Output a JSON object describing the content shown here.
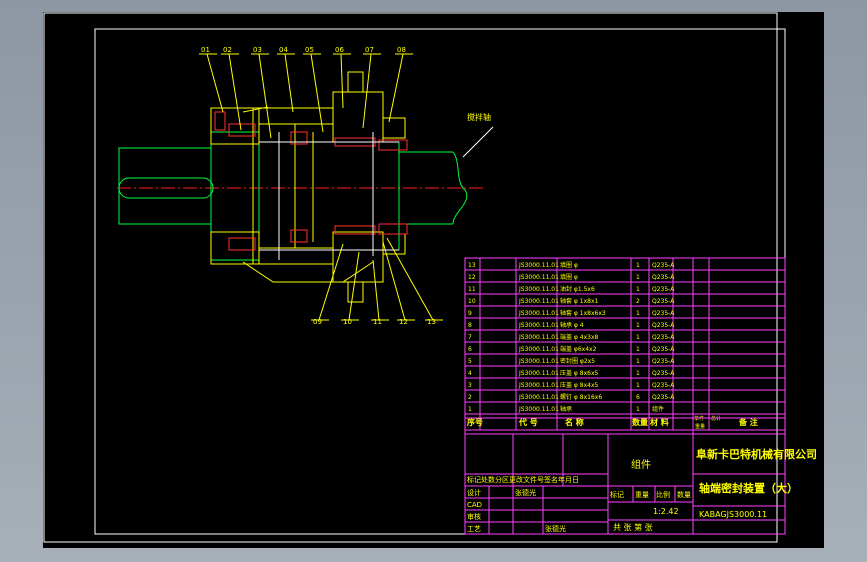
{
  "balloons": [
    "01",
    "02",
    "03",
    "04",
    "05",
    "06",
    "07",
    "08",
    "09",
    "10",
    "11",
    "12",
    "13"
  ],
  "shaft_label": "搅拌轴",
  "bom": [
    {
      "no": "13",
      "code": "JS3000.11.01",
      "name": "填圈 φ",
      "qty": "1",
      "mat": "Q235-A"
    },
    {
      "no": "12",
      "code": "JS3000.11.01",
      "name": "填圈 φ",
      "qty": "1",
      "mat": "Q235-A"
    },
    {
      "no": "11",
      "code": "JS3000.11.01",
      "name": "油封 φ1.5x6",
      "qty": "1",
      "mat": "Q235-A"
    },
    {
      "no": "10",
      "code": "JS3000.11.01",
      "name": "轴套 φ 1x8x1",
      "qty": "2",
      "mat": "Q235-A"
    },
    {
      "no": "9",
      "code": "JS3000.11.01",
      "name": "轴套 φ 1x8x6x3",
      "qty": "1",
      "mat": "Q235-A"
    },
    {
      "no": "8",
      "code": "JS3000.11.01",
      "name": "轴承 φ 4",
      "qty": "1",
      "mat": "Q235-A"
    },
    {
      "no": "7",
      "code": "JS3000.11.01",
      "name": "端盖 φ 4x3x8",
      "qty": "1",
      "mat": "Q235-A"
    },
    {
      "no": "6",
      "code": "JS3000.11.01",
      "name": "端盖 φ6x4x2",
      "qty": "1",
      "mat": "Q235-A"
    },
    {
      "no": "5",
      "code": "JS3000.11.01",
      "name": "密封圈 φ2x5",
      "qty": "1",
      "mat": "Q235-A"
    },
    {
      "no": "4",
      "code": "JS3000.11.01",
      "name": "压盖 φ 8x6x5",
      "qty": "1",
      "mat": "Q235-A"
    },
    {
      "no": "3",
      "code": "JS3000.11.01",
      "name": "压盖 φ 8x4x5",
      "qty": "1",
      "mat": "Q235-A"
    },
    {
      "no": "2",
      "code": "JS3000.11.01",
      "name": "螺钉 φ 8x16x6",
      "qty": "6",
      "mat": "Q235-A"
    },
    {
      "no": "1",
      "code": "JS3000.11.01",
      "name": "轴承",
      "qty": "1",
      "mat": "组件"
    }
  ],
  "bom_header": {
    "no": "序号",
    "code": "代  号",
    "name": "名  称",
    "qty": "数量",
    "mat": "材  料",
    "single": "单件",
    "total": "总计",
    "weight": "重量",
    "remark": "备  注"
  },
  "title_block": {
    "company": "阜新卡巴特机械有限公司",
    "drawing_name": "轴端密封装置（大）",
    "drawing_no": "KABAGJS3000.11",
    "group_label": "组件",
    "scale": "1:2.42",
    "sheet": "共  张  第  张",
    "stage_headers": [
      "标记",
      "重量",
      "比例",
      "数量"
    ],
    "change_row": "标记处数分区更改文件号签名年月日",
    "roles": [
      "设计",
      "CAD",
      "审核",
      "工艺"
    ],
    "designer": "张德光",
    "role_name_2": "张德光"
  }
}
